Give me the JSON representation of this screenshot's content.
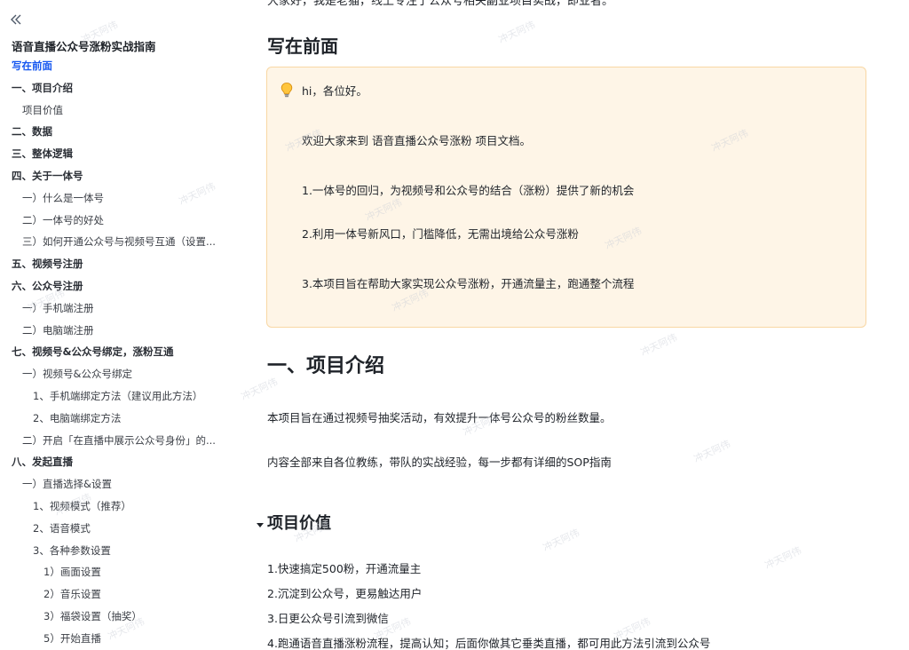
{
  "sidebar": {
    "doc_title": "语音直播公众号涨粉实战指南",
    "items": [
      {
        "label": "写在前面",
        "level": 1,
        "active": true
      },
      {
        "label": "一、项目介绍",
        "level": 1
      },
      {
        "label": "项目价值",
        "level": 2
      },
      {
        "label": "二、数据",
        "level": 1
      },
      {
        "label": "三、整体逻辑",
        "level": 1
      },
      {
        "label": "四、关于一体号",
        "level": 1
      },
      {
        "label": "一）什么是一体号",
        "level": 2
      },
      {
        "label": "二）一体号的好处",
        "level": 2
      },
      {
        "label": "三）如何开通公众号与视频号互通（设置...",
        "level": 2
      },
      {
        "label": "五、视频号注册",
        "level": 1
      },
      {
        "label": "六、公众号注册",
        "level": 1
      },
      {
        "label": "一）手机端注册",
        "level": 2
      },
      {
        "label": "二）电脑端注册",
        "level": 2
      },
      {
        "label": "七、视频号&公众号绑定，涨粉互通",
        "level": 1
      },
      {
        "label": "一）视频号&公众号绑定",
        "level": 2
      },
      {
        "label": "1、手机端绑定方法（建议用此方法）",
        "level": 3
      },
      {
        "label": "2、电脑端绑定方法",
        "level": 3
      },
      {
        "label": "二）开启「在直播中展示公众号身份」的...",
        "level": 2
      },
      {
        "label": "八、发起直播",
        "level": 1
      },
      {
        "label": "一）直播选择&设置",
        "level": 2
      },
      {
        "label": "1、视频模式（推荐）",
        "level": 3
      },
      {
        "label": "2、语音模式",
        "level": 3
      },
      {
        "label": "3、各种参数设置",
        "level": 3
      },
      {
        "label": "1）画面设置",
        "level": 4
      },
      {
        "label": "2）音乐设置",
        "level": 4
      },
      {
        "label": "3）福袋设置（抽奖）",
        "level": 4
      },
      {
        "label": "5）开始直播",
        "level": 4
      }
    ]
  },
  "main": {
    "intro_cut": "大家好，我是老猫，线上专注于公众号相关副业项目实战，即业者。",
    "section_foreword": {
      "title": "写在前面",
      "callout_icon": "lightbulb-icon",
      "callout_lines": [
        "hi，各位好。",
        "欢迎大家来到 语音直播公众号涨粉 项目文档。",
        "1.一体号的回归，为视频号和公众号的结合（涨粉）提供了新的机会",
        "2.利用一体号新风口，门槛降低，无需出境给公众号涨粉",
        "3.本项目旨在帮助大家实现公众号涨粉，开通流量主，跑通整个流程"
      ]
    },
    "section_intro": {
      "title": "一、项目介绍",
      "paragraphs": [
        "本项目旨在通过视频号抽奖活动，有效提升一体号公众号的粉丝数量。",
        "内容全部来自各位教练，带队的实战经验，每一步都有详细的SOP指南"
      ]
    },
    "section_value": {
      "title": "项目价值",
      "items": [
        "1.快速搞定500粉，开通流量主",
        "2.沉淀到公众号，更易触达用户",
        "3.日更公众号引流到微信",
        "4.跑通语音直播涨粉流程，提高认知；后面你做其它垂类直播，都可用此方法引流到公众号"
      ]
    },
    "watermark": "冲天阿伟"
  },
  "colors": {
    "accent": "#1456f0",
    "callout_bg": "#fef5e7",
    "callout_border": "#f8d7a4",
    "text": "#1f2329"
  }
}
